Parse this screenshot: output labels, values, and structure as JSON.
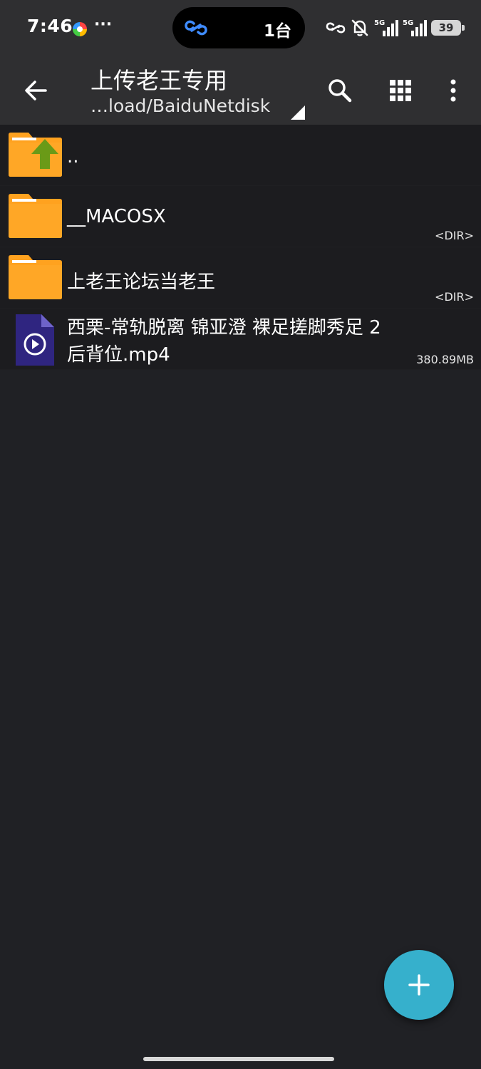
{
  "status_bar": {
    "time": "7:46",
    "more": "···",
    "island_text": "1台",
    "network_1": "5G",
    "network_2": "5G",
    "battery_level": "39"
  },
  "toolbar": {
    "title": "上传老王专用",
    "path": "…load/BaiduNetdisk",
    "icons": [
      "back-arrow-icon",
      "search-icon",
      "grid-view-icon",
      "overflow-menu-icon"
    ]
  },
  "files": [
    {
      "name": "..",
      "meta": "",
      "type": "parent-folder"
    },
    {
      "name": "__MACOSX",
      "meta": "<DIR>",
      "type": "folder"
    },
    {
      "name": "上老王论坛当老王",
      "meta": "<DIR>",
      "type": "folder"
    },
    {
      "name_line1": "西栗-常轨脱离 锦亚澄 裸足搓脚秀足 2",
      "name_line2": "后背位.mp4",
      "meta": "380.89MB",
      "type": "video"
    }
  ],
  "fab": {
    "icon": "plus-icon"
  },
  "colors": {
    "toolbar_bg": "#2f2f31",
    "list_bg": "#1c1c1f",
    "page_bg": "#202125",
    "folder": "#ffa21f",
    "up_arrow": "#6a9a17",
    "video_icon": "#2f2580",
    "fab": "#36b0cc"
  }
}
